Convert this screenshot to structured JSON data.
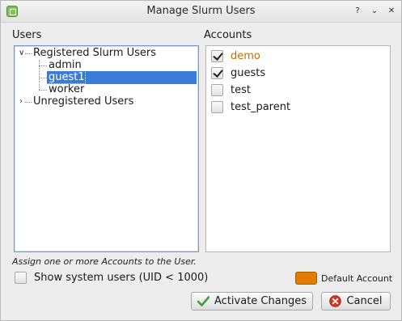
{
  "window": {
    "title": "Manage Slurm Users"
  },
  "users": {
    "label": "Users",
    "tree": {
      "registered_label": "Registered Slurm Users",
      "registered_children": [
        "admin",
        "guest1",
        "worker"
      ],
      "selected": "guest1",
      "unregistered_label": "Unregistered Users"
    }
  },
  "accounts": {
    "label": "Accounts",
    "items": [
      {
        "name": "demo",
        "checked": true,
        "is_default": true
      },
      {
        "name": "guests",
        "checked": true,
        "is_default": false
      },
      {
        "name": "test",
        "checked": false,
        "is_default": false
      },
      {
        "name": "test_parent",
        "checked": false,
        "is_default": false
      }
    ],
    "default_color": "#c86a00"
  },
  "hint": "Assign one or more Accounts to the User.",
  "show_system_users": {
    "label": "Show system users (UID < 1000)",
    "checked": false
  },
  "legend": {
    "label": "Default Account",
    "color": "#e07b00"
  },
  "buttons": {
    "activate": "Activate Changes",
    "cancel": "Cancel"
  },
  "icons": {
    "app": "app-icon",
    "help": "question-icon",
    "minimize": "chevron-down-icon",
    "close": "close-icon"
  }
}
